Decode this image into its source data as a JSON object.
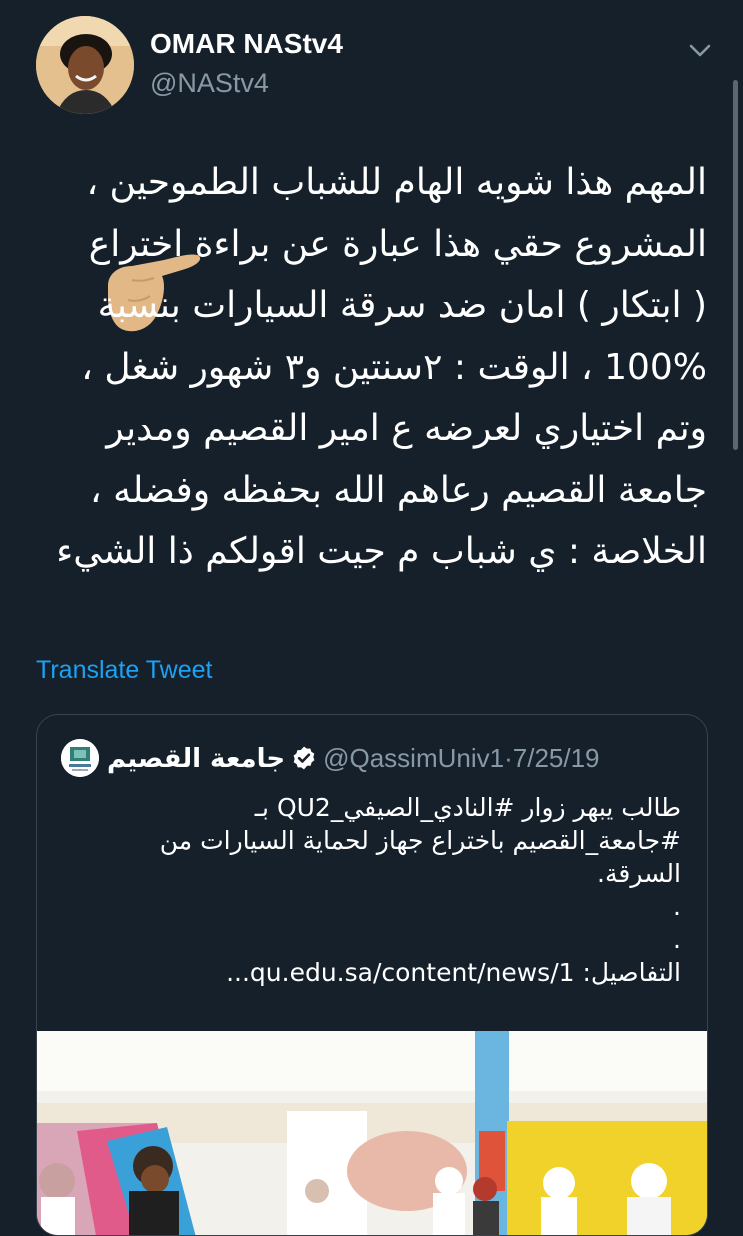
{
  "tweet": {
    "author_name": "OMAR NAStv4",
    "author_handle": "@NAStv4",
    "lines": [
      "المهم هذا شويه الهام للشباب الطموحين ،",
      "المشروع حقي هذا عبارة عن براءة اختراع",
      "( ابتكار ) امان ضد سرقة السيارات بنسبة",
      "100% ،  الوقت : ٢سنتين و٣ شهور شغل ،",
      "وتم اختياري لعرضه ع امير القصيم ومدير",
      "جامعة القصيم رعاهم الله بحفظه وفضله ،",
      "الخلاصة : ي شباب م جيت اقولكم ذا الشيء"
    ],
    "translate_label": "Translate Tweet"
  },
  "quote": {
    "name": "جامعة القصيم",
    "handle": "@QassimUniv1",
    "separator": "·",
    "date": "7/25/19",
    "lines": [
      "طالب يبهر زوار #النادي_الصيفي_QU2 بـ",
      "#جامعة_القصيم باختراع جهاز لحماية السيارات من",
      "السرقة.",
      ".",
      ".",
      "التفاصيل: qu.edu.sa/content/news/1..."
    ]
  },
  "icons": {
    "avatar": "avatar-photo",
    "menu": "chevron-down-icon",
    "pointer": "pointing-hand-icon",
    "verified": "verified-badge-icon"
  },
  "colors": {
    "background": "#15202b",
    "text": "#ffffff",
    "secondary": "#8899a6",
    "link": "#1da1f2",
    "border": "#38444d"
  }
}
